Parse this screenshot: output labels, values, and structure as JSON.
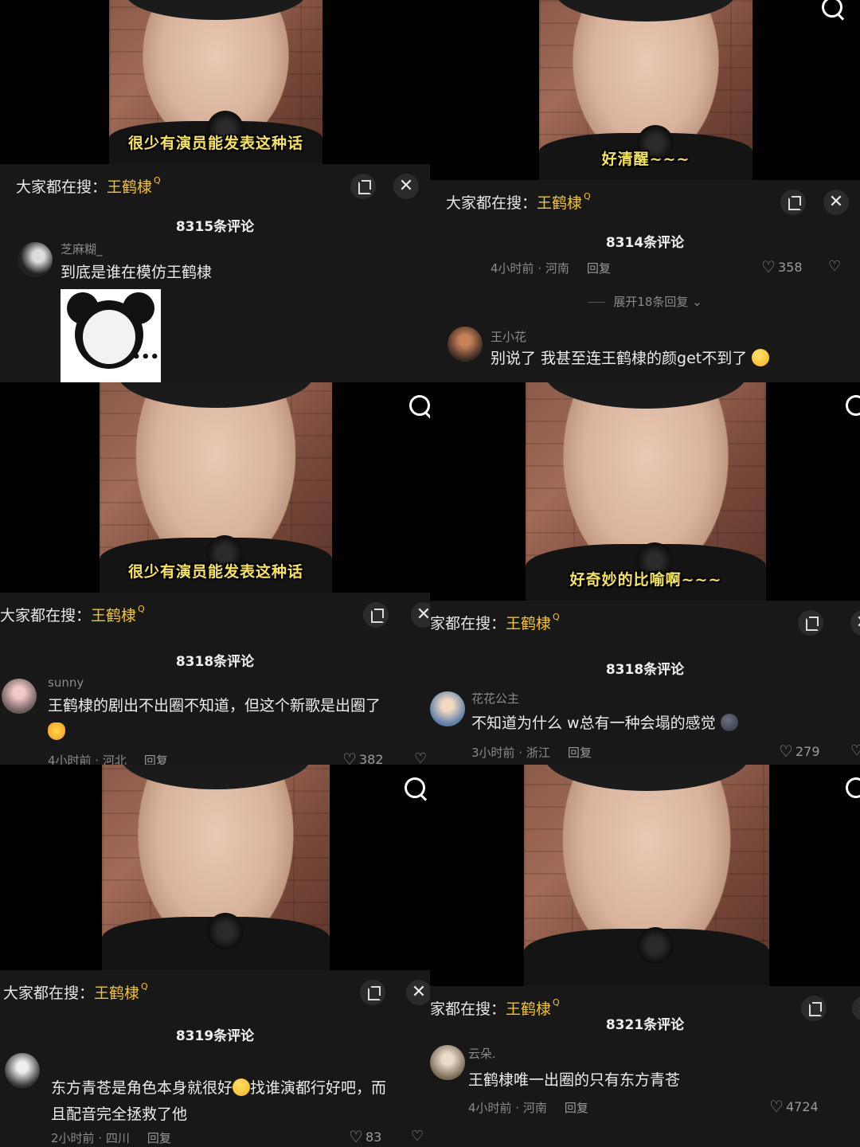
{
  "panels": [
    {
      "subtitle": "很少有演员能发表这种话",
      "hot_prefix": "大家都在搜：",
      "hot_keyword": "王鹤棣",
      "comment_count": "8315条评论",
      "comment": {
        "username": "芝麻糊_",
        "text": "到底是谁在模仿王鹤棣"
      }
    },
    {
      "subtitle": "好清醒~~~",
      "hot_prefix": "大家都在搜：",
      "hot_keyword": "王鹤棣",
      "comment_count": "8314条评论",
      "top_meta": {
        "time_loc": "4小时前 · 河南",
        "reply": "回复",
        "likes": "358"
      },
      "expand_replies": "展开18条回复",
      "comment": {
        "username": "王小花",
        "text": "别说了 我甚至连王鹤棣的颜get不到了"
      }
    },
    {
      "subtitle": "很少有演员能发表这种话",
      "hot_prefix": "大家都在搜：",
      "hot_keyword": "王鹤棣",
      "comment_count": "8318条评论",
      "comment": {
        "username": "sunny",
        "text": "王鹤棣的剧出不出圈不知道，但这个新歌是出圈了",
        "time_loc": "4小时前 · 河北",
        "reply": "回复",
        "likes": "382"
      }
    },
    {
      "subtitle": "好奇妙的比喻啊~~~",
      "hot_prefix": "家都在搜：",
      "hot_keyword": "王鹤棣",
      "comment_count": "8318条评论",
      "comment": {
        "username": "花花公主",
        "text": "不知道为什么 w总有一种会塌的感觉",
        "time_loc": "3小时前 · 浙江",
        "reply": "回复",
        "likes": "279"
      }
    },
    {
      "subtitle": "",
      "hot_prefix": "大家都在搜：",
      "hot_keyword": "王鹤棣",
      "comment_count": "8319条评论",
      "comment": {
        "username": "",
        "text_line1": "东方青苍是角色本身就很好",
        "text_line1b": "找谁演都行好吧，而",
        "text_line2": "且配音完全拯救了他",
        "time_loc": "2小时前 · 四川",
        "reply": "回复",
        "likes": "83"
      }
    },
    {
      "subtitle": "",
      "hot_prefix": "家都在搜：",
      "hot_keyword": "王鹤棣",
      "comment_count": "8321条评论",
      "comment": {
        "username": "云朵.",
        "text": "王鹤棣唯一出圈的只有东方青苍",
        "time_loc": "4小时前 · 河南",
        "reply": "回复",
        "likes": "4724"
      }
    }
  ],
  "icons": {
    "search": "search-icon",
    "expand": "expand-icon",
    "close": "close-icon",
    "heart": "heart-icon",
    "dislike": "dislike-icon"
  },
  "colors": {
    "keyword": "#f5c518",
    "subtitle": "#f7e45a",
    "panel_bg": "#181818"
  }
}
